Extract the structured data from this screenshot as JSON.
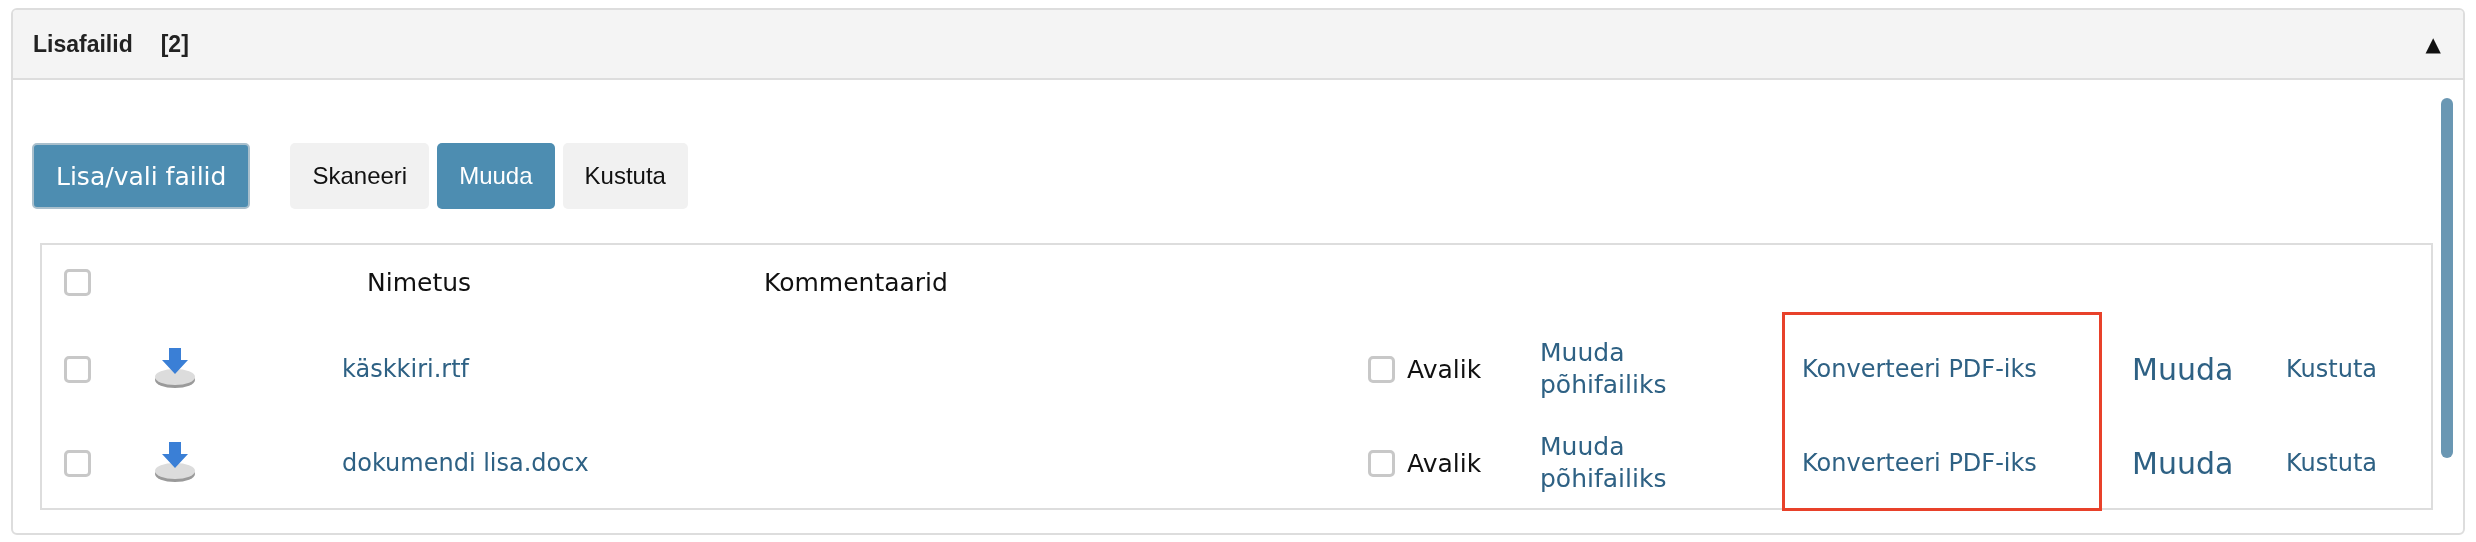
{
  "panel": {
    "title": "Lisafailid",
    "count": "[2]",
    "toggle": "▲",
    "expanded": true
  },
  "add_button": {
    "label": "Lisa/vali failid"
  },
  "buttons": [
    {
      "label": "Skaneeri",
      "kind": "secondary"
    },
    {
      "label": "Muuda",
      "kind": "primary"
    },
    {
      "label": "Kustuta",
      "kind": "secondary"
    }
  ],
  "table": {
    "select_all": {
      "checked": false
    },
    "columns": [
      "Nimetus",
      "Kommentaarid"
    ],
    "highlight": {
      "color": "#e8412a"
    },
    "rows": [
      {
        "checked": false,
        "name": "käskkiri.rtf",
        "public": {
          "label": "Avalik",
          "checked": false
        },
        "make_main": "Muuda põhifailiks",
        "convert": "Konverteeri PDF-iks",
        "edit": "Muuda",
        "delete": "Kustuta"
      },
      {
        "checked": false,
        "name": "dokumendi lisa.docx",
        "public": {
          "label": "Avalik",
          "checked": false
        },
        "make_main": "Muuda põhifailiks",
        "convert": "Konverteeri PDF-iks",
        "edit": "Muuda",
        "delete": "Kustuta"
      }
    ]
  }
}
